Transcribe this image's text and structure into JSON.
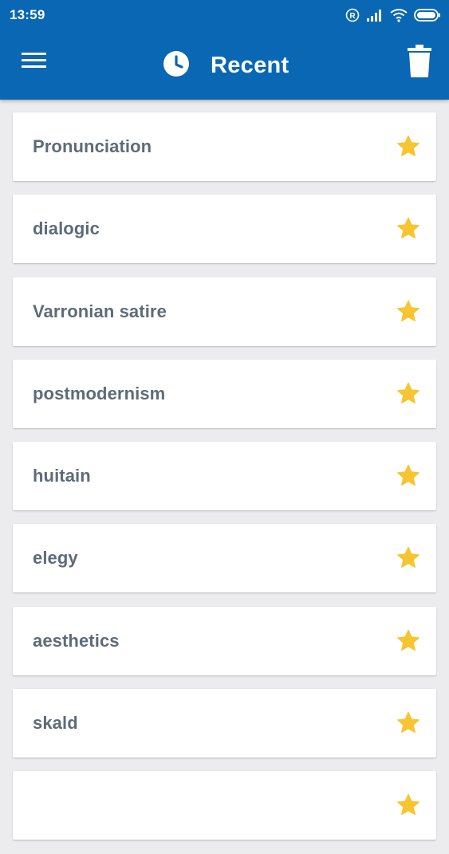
{
  "status_bar": {
    "time": "13:59",
    "icons": [
      "registered-icon",
      "signal-icon",
      "wifi-icon",
      "battery-icon"
    ]
  },
  "toolbar": {
    "title": "Recent",
    "menu_icon": "hamburger-menu-icon",
    "title_icon": "clock-icon",
    "action_icon": "trash-icon"
  },
  "colors": {
    "appbar": "#0a67b3",
    "background": "#ececee",
    "card": "#ffffff",
    "item_text": "#5e6b79",
    "star": "#f7c531"
  },
  "items": [
    {
      "label": "Pronunciation",
      "starred": true
    },
    {
      "label": "dialogic",
      "starred": true
    },
    {
      "label": "Varronian satire",
      "starred": true
    },
    {
      "label": "postmodernism",
      "starred": true
    },
    {
      "label": "huitain",
      "starred": true
    },
    {
      "label": "elegy",
      "starred": true
    },
    {
      "label": "aesthetics",
      "starred": true
    },
    {
      "label": "skald",
      "starred": true
    },
    {
      "label": "",
      "starred": true
    }
  ]
}
